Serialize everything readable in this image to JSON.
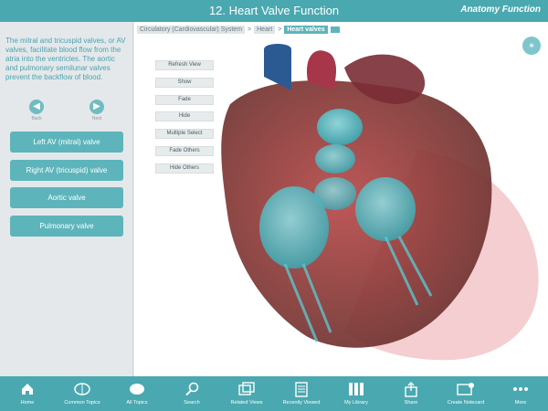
{
  "header": {
    "title": "12. Heart Valve Function",
    "brand": "Anatomy Function"
  },
  "description": "The mitral and tricuspid valves, or AV valves, facilitate blood flow from the atria into the ventricles. The aortic and pulmonary semilunar valves prevent the backflow of blood.",
  "nav": {
    "back": "Back",
    "next": "Next"
  },
  "valves": [
    "Left AV (mitral) valve",
    "Right AV (tricuspid) valve",
    "Aortic valve",
    "Pulmonary valve"
  ],
  "breadcrumb": {
    "items": [
      "Circulatory (Cardiovascular) System",
      "Heart",
      "Heart valves"
    ],
    "separator": ">"
  },
  "controls": [
    "Refresh View",
    "Show",
    "Fade",
    "Hide",
    "Multiple Select",
    "Fade Others",
    "Hide Others"
  ],
  "toolbar": [
    "Home",
    "Common Topics",
    "All Topics",
    "Search",
    "Related Views",
    "Recently Viewed",
    "My Library",
    "Share",
    "Create Notecard",
    "More"
  ],
  "colors": {
    "accent": "#4aa8b0",
    "button": "#5db5bb",
    "valve": "#4fc3cb"
  },
  "icons": {
    "home": "home-icon",
    "common_topics": "brain-icon",
    "all_topics": "brain-icon",
    "search": "magnifier-icon",
    "related_views": "images-icon",
    "recently_viewed": "document-icon",
    "my_library": "books-icon",
    "share": "share-icon",
    "create_notecard": "notecard-icon",
    "more": "ellipsis-icon",
    "tip": "lightbulb-icon"
  }
}
